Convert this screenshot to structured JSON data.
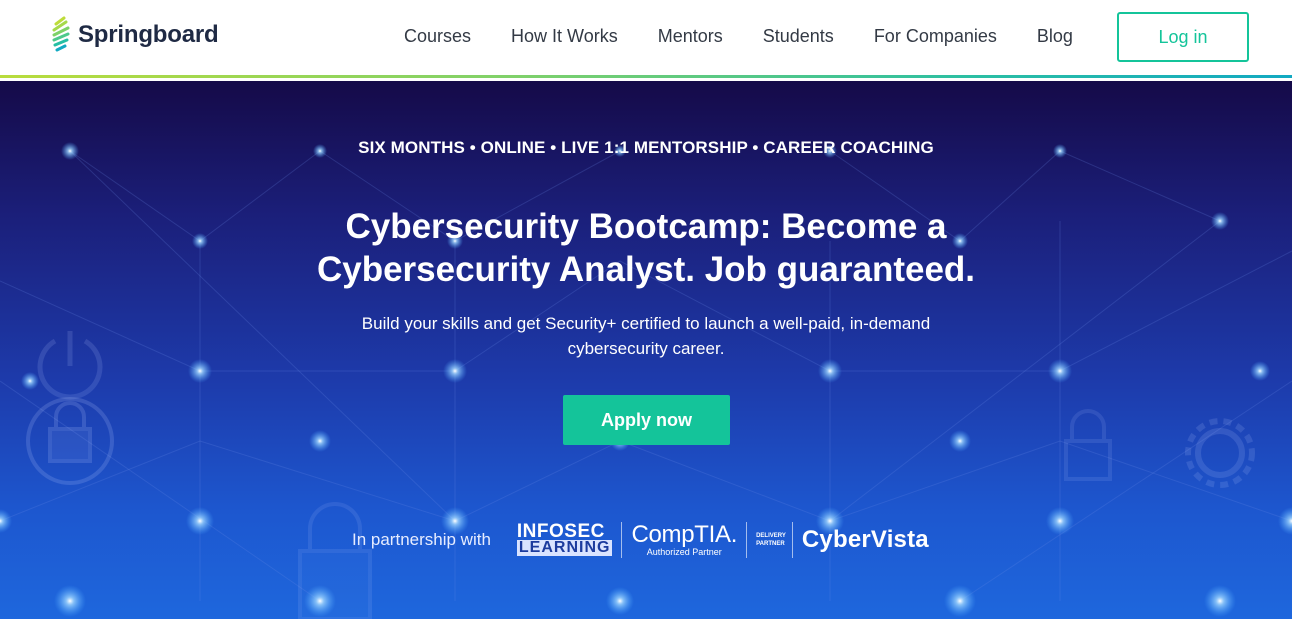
{
  "header": {
    "logo_text": "Springboard",
    "nav": [
      "Courses",
      "How It Works",
      "Mentors",
      "Students",
      "For Companies",
      "Blog"
    ],
    "login_label": "Log in"
  },
  "hero": {
    "eyebrow": "SIX MONTHS • ONLINE • LIVE 1:1 MENTORSHIP • CAREER COACHING",
    "headline_line1": "Cybersecurity Bootcamp: Become a",
    "headline_line2": "Cybersecurity Analyst. Job guaranteed.",
    "subtext_line1": "Build your skills and get Security+ certified to launch a well-paid, in-demand",
    "subtext_line2": "cybersecurity career.",
    "apply_label": "Apply now"
  },
  "partners": {
    "label": "In partnership with",
    "infosec_line1": "INFOSEC",
    "infosec_line2": "LEARNING",
    "comptia_name": "CompTIA.",
    "comptia_sub": "Authorized Partner",
    "delivery_line1": "DELIVERY",
    "delivery_line2": "PARTNER",
    "cybervista": "CyberVista"
  },
  "colors": {
    "accent": "#14c49a",
    "logo_text": "#1f2a44",
    "hero_top": "#150a48",
    "hero_bottom": "#1e67dd"
  },
  "icons": [
    "springboard-logo-icon",
    "lock-icon",
    "power-icon",
    "gear-icon"
  ]
}
